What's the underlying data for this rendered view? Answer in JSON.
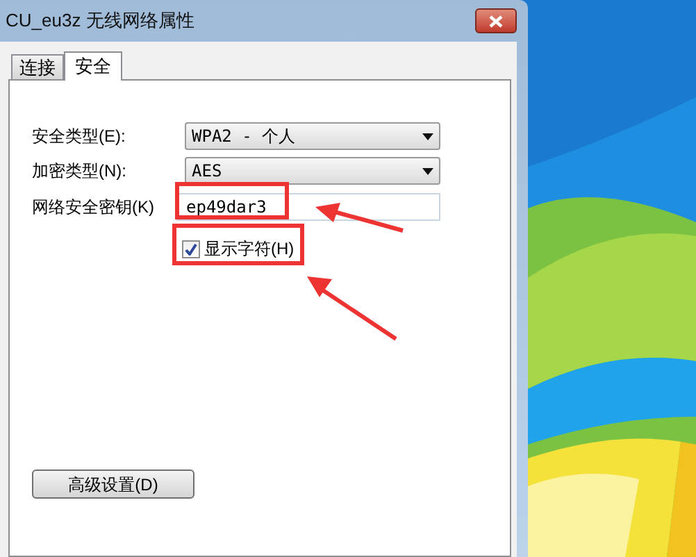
{
  "window": {
    "title": "CU_eu3z 无线网络属性"
  },
  "tabs": [
    {
      "label": "连接",
      "selected": false
    },
    {
      "label": "安全",
      "selected": true
    }
  ],
  "security_type": {
    "label": "安全类型(E):",
    "value": "WPA2 - 个人"
  },
  "encryption_type": {
    "label": "加密类型(N):",
    "value": "AES"
  },
  "network_key": {
    "label": "网络安全密钥(K)",
    "value": "ep49dar3"
  },
  "show_characters": {
    "label": "显示字符(H)",
    "checked": true
  },
  "advanced_button": {
    "label": "高级设置(D)"
  }
}
